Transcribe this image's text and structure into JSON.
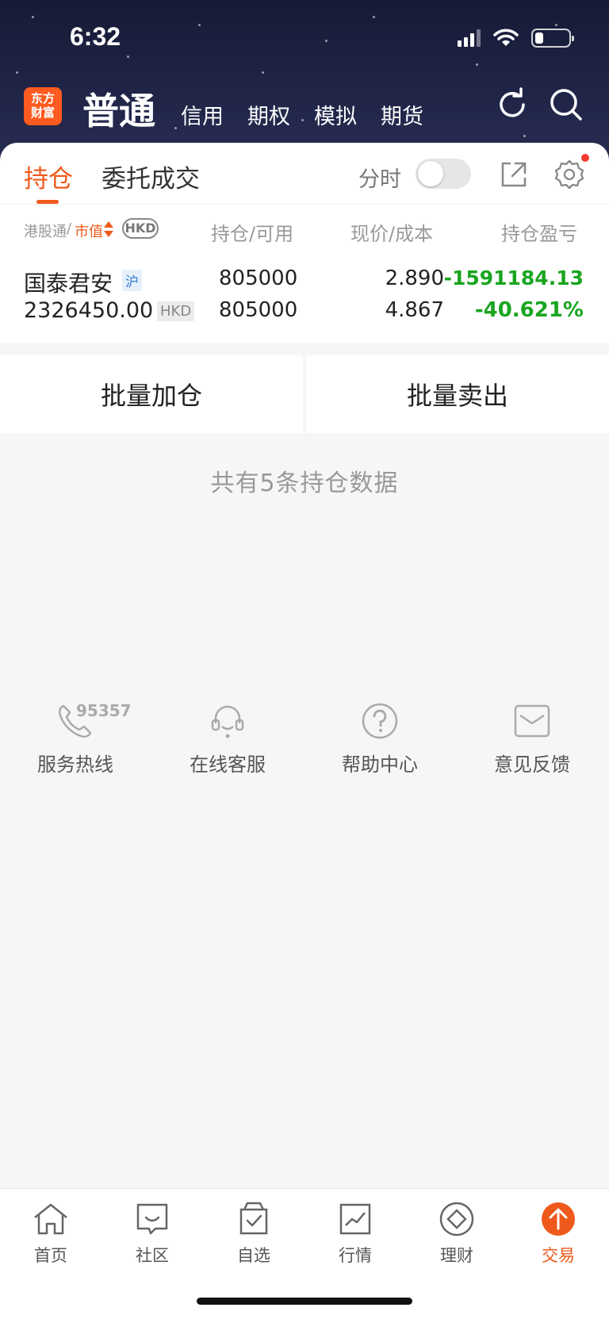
{
  "status_bar": {
    "time": "6:32"
  },
  "header": {
    "logo_line1": "东方",
    "logo_line2": "财富",
    "account_tabs": [
      {
        "label": "普通",
        "active": true
      },
      {
        "label": "信用"
      },
      {
        "label": "期权"
      },
      {
        "label": "模拟"
      },
      {
        "label": "期货"
      }
    ],
    "icons": [
      "refresh-icon",
      "search-icon"
    ]
  },
  "position_tabs": {
    "holdings": "持仓",
    "orders": "委托成交",
    "fenshi_label": "分时",
    "fenshi_enabled": false
  },
  "columns": {
    "hk_connect": "港股通",
    "sep": "/",
    "market_value": "市值",
    "currency": "HKD",
    "holding_available": "持仓/可用",
    "price_cost": "现价/成本",
    "pnl": "持仓盈亏"
  },
  "holdings": [
    {
      "name": "国泰君安",
      "market": "沪",
      "market_value": "2326450.00",
      "currency": "HKD",
      "holding": "805000",
      "available": "805000",
      "price": "2.890",
      "cost": "4.867",
      "pnl": "-1591184.13",
      "pnl_pct": "-40.621%"
    }
  ],
  "actions": {
    "batch_add": "批量加仓",
    "batch_sell": "批量卖出"
  },
  "summary_text": "共有5条持仓数据",
  "services": [
    {
      "label": "服务热线",
      "icon": "phone-icon",
      "number": "95357"
    },
    {
      "label": "在线客服",
      "icon": "headset-icon"
    },
    {
      "label": "帮助中心",
      "icon": "help-icon"
    },
    {
      "label": "意见反馈",
      "icon": "mail-icon"
    }
  ],
  "bottom_nav": [
    {
      "label": "首页",
      "icon": "home-icon"
    },
    {
      "label": "社区",
      "icon": "community-icon"
    },
    {
      "label": "自选",
      "icon": "watchlist-icon"
    },
    {
      "label": "行情",
      "icon": "market-icon"
    },
    {
      "label": "理财",
      "icon": "wealth-icon"
    },
    {
      "label": "交易",
      "icon": "trade-icon",
      "active": true
    }
  ],
  "colors": {
    "accent": "#ee5a1c",
    "gain_loss_green": "#1aa521",
    "header_bg": "#1f2446"
  }
}
